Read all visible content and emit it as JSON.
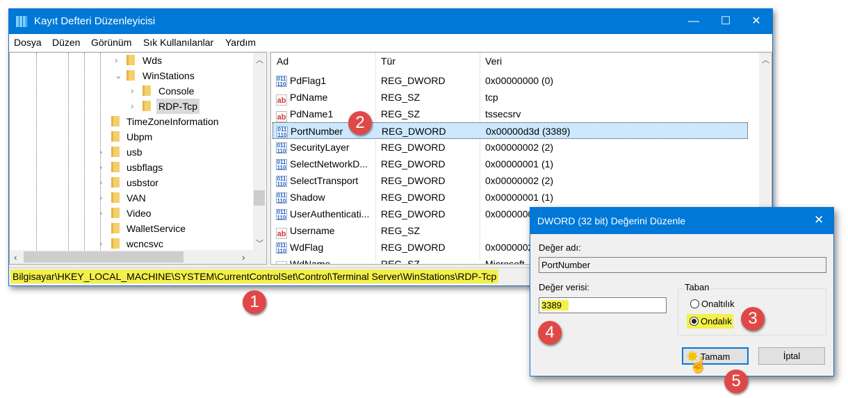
{
  "window": {
    "title": "Kayıt Defteri Düzenleyicisi",
    "minimize": "—",
    "maximize": "☐",
    "close": "✕"
  },
  "menu": [
    "Dosya",
    "Düzen",
    "Görünüm",
    "Sık Kullanılanlar",
    "Yardım"
  ],
  "tree": [
    {
      "label": "Wds",
      "level": 2,
      "chevron": "›"
    },
    {
      "label": "WinStations",
      "level": 2,
      "chevron": "⌄"
    },
    {
      "label": "Console",
      "level": 3,
      "chevron": "›"
    },
    {
      "label": "RDP-Tcp",
      "level": 3,
      "chevron": "›",
      "selected": true
    },
    {
      "label": "TimeZoneInformation",
      "level": 1,
      "chevron": ""
    },
    {
      "label": "Ubpm",
      "level": 1,
      "chevron": ""
    },
    {
      "label": "usb",
      "level": 1,
      "chevron": "›"
    },
    {
      "label": "usbflags",
      "level": 1,
      "chevron": "›"
    },
    {
      "label": "usbstor",
      "level": 1,
      "chevron": "›"
    },
    {
      "label": "VAN",
      "level": 1,
      "chevron": "›"
    },
    {
      "label": "Video",
      "level": 1,
      "chevron": "›"
    },
    {
      "label": "WalletService",
      "level": 1,
      "chevron": ""
    },
    {
      "label": "wcncsvc",
      "level": 1,
      "chevron": "›"
    }
  ],
  "list": {
    "headers": [
      "Ad",
      "Tür",
      "Veri"
    ],
    "rows": [
      {
        "name": "PdFlag1",
        "type": "REG_DWORD",
        "data": "0x00000000 (0)",
        "icon": "binary"
      },
      {
        "name": "PdName",
        "type": "REG_SZ",
        "data": "tcp",
        "icon": "string"
      },
      {
        "name": "PdName1",
        "type": "REG_SZ",
        "data": "tssecsrv",
        "icon": "string"
      },
      {
        "name": "PortNumber",
        "type": "REG_DWORD",
        "data": "0x00000d3d (3389)",
        "icon": "binary",
        "selected": true
      },
      {
        "name": "SecurityLayer",
        "type": "REG_DWORD",
        "data": "0x00000002 (2)",
        "icon": "binary"
      },
      {
        "name": "SelectNetworkD...",
        "type": "REG_DWORD",
        "data": "0x00000001 (1)",
        "icon": "binary"
      },
      {
        "name": "SelectTransport",
        "type": "REG_DWORD",
        "data": "0x00000002 (2)",
        "icon": "binary"
      },
      {
        "name": "Shadow",
        "type": "REG_DWORD",
        "data": "0x00000001 (1)",
        "icon": "binary"
      },
      {
        "name": "UserAuthenticati...",
        "type": "REG_DWORD",
        "data": "0x0000000",
        "icon": "binary"
      },
      {
        "name": "Username",
        "type": "REG_SZ",
        "data": "",
        "icon": "string"
      },
      {
        "name": "WdFlag",
        "type": "REG_DWORD",
        "data": "0x0000002",
        "icon": "binary"
      },
      {
        "name": "WdName",
        "type": "REG_SZ",
        "data": "Microsoft",
        "icon": "string"
      }
    ]
  },
  "status": {
    "path": "Bilgisayar\\HKEY_LOCAL_MACHINE\\SYSTEM\\CurrentControlSet\\Control\\Terminal Server\\WinStations\\RDP-Tcp"
  },
  "dialog": {
    "title": "DWORD (32 bit) Değerini Düzenle",
    "close": "✕",
    "name_label": "Değer adı:",
    "name_value": "PortNumber",
    "data_label": "Değer verisi:",
    "data_value": "3389",
    "base_label": "Taban",
    "hex_label": "Onaltılık",
    "dec_label": "Ondalık",
    "ok": "Tamam",
    "cancel": "İptal"
  },
  "badges": [
    "1",
    "2",
    "3",
    "4",
    "5"
  ],
  "colors": {
    "accent": "#0078d7",
    "highlight": "#f3f04a",
    "badge": "#e04848",
    "selection": "#cce8ff"
  }
}
